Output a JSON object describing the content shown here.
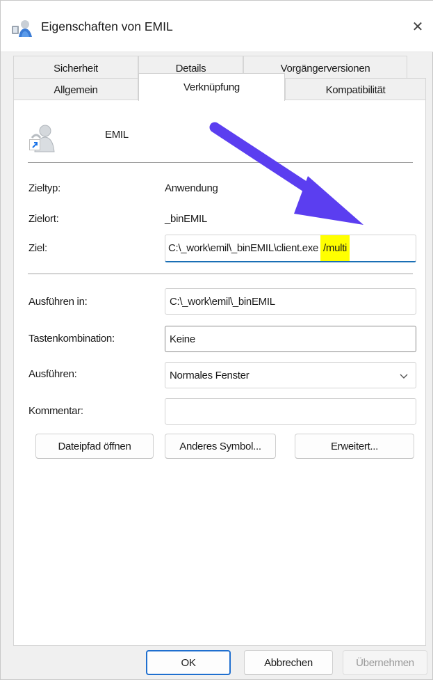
{
  "window": {
    "title": "Eigenschaften von EMIL",
    "close_symbol": "✕",
    "icons": {
      "title": "shortcut-properties-icon",
      "close": "close-icon"
    }
  },
  "tabs_row1": [
    "Sicherheit",
    "Details",
    "Vorgängerversionen"
  ],
  "tabs_row2": [
    "Allgemein",
    "Verknüpfung",
    "Kompatibilität"
  ],
  "active_tab": "Verknüpfung",
  "shortcut": {
    "name": "EMIL",
    "icon": "emil-app-icon",
    "overlay_icon": "shortcut-arrow-icon"
  },
  "info": {
    "zieltyp_label": "Zieltyp:",
    "zieltyp_value": "Anwendung",
    "zielort_label": "Zielort:",
    "zielort_value": "_binEMIL",
    "ziel_label": "Ziel:",
    "ziel_value": "C:\\_work\\emil\\_binEMIL\\client.exe",
    "ziel_highlight": "/multi",
    "highlight_color": "#ffff00",
    "arrow_color": "#5b3ef0"
  },
  "form": {
    "ausfuehren_in_label": "Ausführen in:",
    "ausfuehren_in_value": "C:\\_work\\emil\\_binEMIL",
    "tastenkombination_label": "Tastenkombination:",
    "tastenkombination_value": "Keine",
    "ausfuehren_label": "Ausführen:",
    "ausfuehren_value": "Normales Fenster",
    "kommentar_label": "Kommentar:",
    "kommentar_value": ""
  },
  "buttons": {
    "dateipfad": "Dateipfad öffnen",
    "anderes_symbol": "Anderes Symbol...",
    "erweitert": "Erweitert...",
    "ok": "OK",
    "abbrechen": "Abbrechen",
    "uebernehmen": "Übernehmen"
  }
}
